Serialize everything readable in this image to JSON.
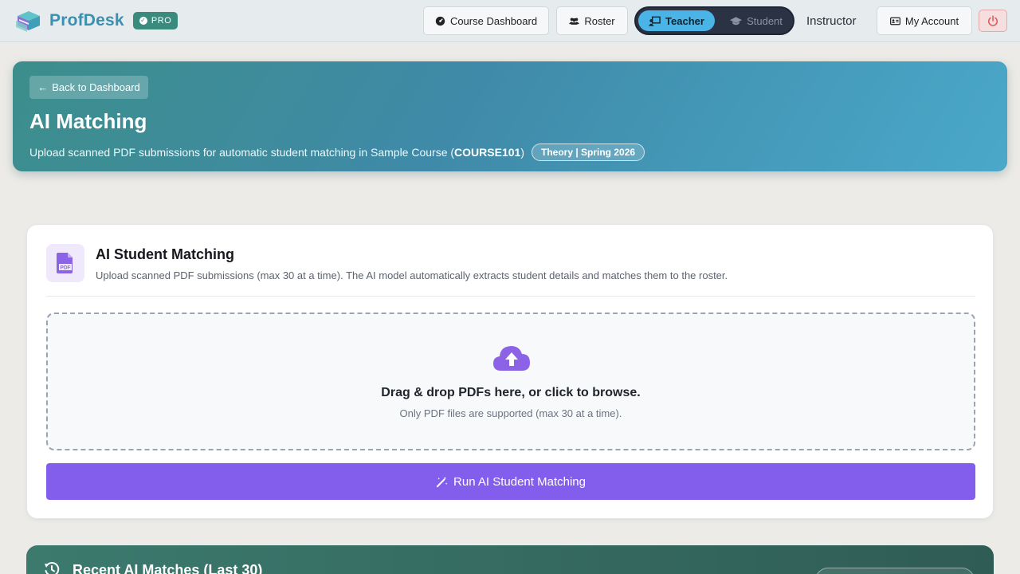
{
  "navbar": {
    "brand_name": "ProfDesk",
    "pro_badge": "PRO",
    "course_dashboard_label": "Course Dashboard",
    "roster_label": "Roster",
    "role_teacher_label": "Teacher",
    "role_student_label": "Student",
    "active_role": "Teacher",
    "user_role_label": "Instructor",
    "my_account_label": "My Account"
  },
  "hero": {
    "back_label": "Back to Dashboard",
    "title": "AI Matching",
    "subtitle_prefix": "Upload scanned PDF submissions for automatic student matching in Sample Course (",
    "course_code": "COURSE101",
    "subtitle_suffix": ")",
    "term_tag": "Theory | Spring 2026"
  },
  "matching_card": {
    "title": "AI Student Matching",
    "description": "Upload scanned PDF submissions (max 30 at a time). The AI model automatically extracts student details and matches them to the roster.",
    "dropzone_title": "Drag & drop PDFs here, or click to browse.",
    "dropzone_note": "Only PDF files are supported (max 30 at a time).",
    "run_button_label": "Run AI Student Matching"
  },
  "recent_matches": {
    "title": "Recent AI Matches (Last 30)"
  },
  "colors": {
    "brand": "#3b8fb0",
    "accent_purple": "#835eec",
    "hero_start": "#3c8e8c",
    "hero_end": "#4aa8c9",
    "teacher_active": "#4bb4e6"
  },
  "icons": {
    "course_dashboard": "gauge-icon",
    "roster": "users-icon",
    "teacher": "chalkboard-teacher-icon",
    "student": "graduation-cap-icon",
    "account": "id-card-icon",
    "logout": "power-icon",
    "back": "arrow-left-icon",
    "card": "file-pdf-icon",
    "dropzone": "cloud-upload-icon",
    "run": "magic-wand-icon",
    "recent": "history-icon"
  }
}
